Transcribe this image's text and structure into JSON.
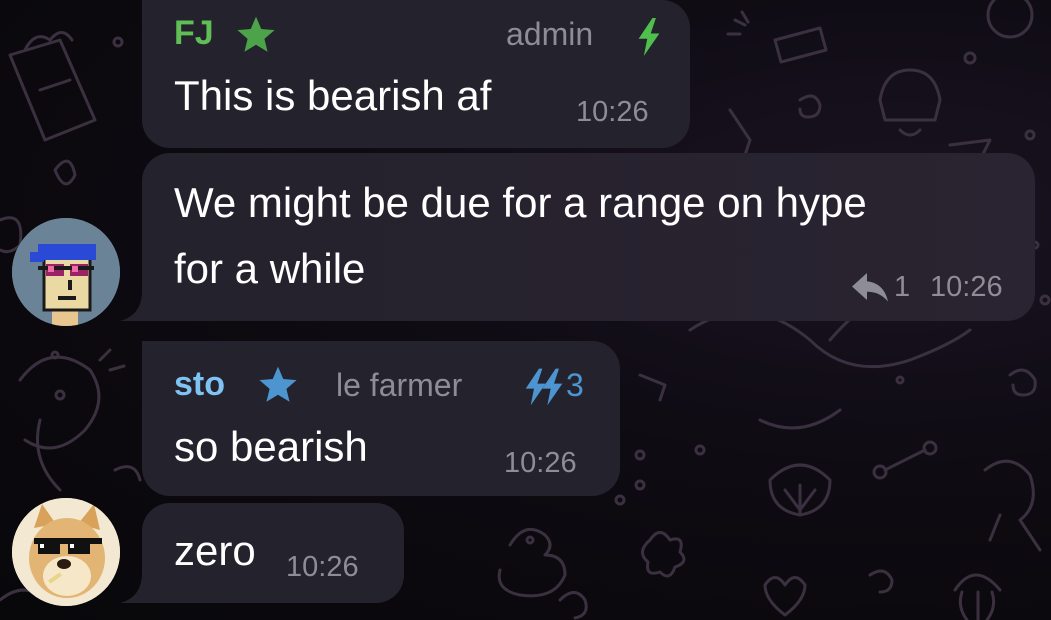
{
  "colors": {
    "bubble": "#24222c",
    "bubble_right": "#2c2533",
    "time": "#8e8c96",
    "fj_name": "#5fbf56",
    "fj_star": "#4da34a",
    "fj_bolt": "#4fc04d",
    "sto_name": "#7fc3f4",
    "sto_star": "#4d95d1",
    "sto_bolt": "#4d95d1"
  },
  "messages": [
    {
      "sender": "FJ",
      "sender_icon": "star-icon",
      "role": "admin",
      "role_icon": "lightning-icon",
      "lines": [
        "This is bearish af"
      ],
      "time": "10:26"
    },
    {
      "lines": [
        "We might be due for a range on hype",
        "for a while"
      ],
      "replies": "1",
      "reply_icon": "reply-arrow-icon",
      "time": "10:26",
      "avatar": "punk-avatar"
    },
    {
      "sender": "sto",
      "sender_icon": "star-icon",
      "role": "le farmer",
      "role_icon": "double-lightning-icon",
      "boost_count": "3",
      "lines": [
        "so bearish"
      ],
      "time": "10:26"
    },
    {
      "lines": [
        "zero"
      ],
      "time": "10:26",
      "avatar": "doge-avatar"
    }
  ]
}
